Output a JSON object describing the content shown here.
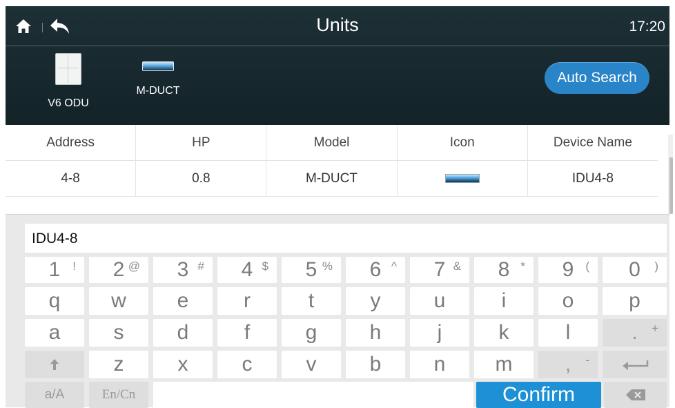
{
  "header": {
    "title": "Units",
    "time": "17:20",
    "devices": [
      {
        "label": "V6 ODU"
      },
      {
        "label": "M-DUCT"
      }
    ],
    "auto_search_label": "Auto Search"
  },
  "table": {
    "columns": [
      "Address",
      "HP",
      "Model",
      "Icon",
      "Device Name"
    ],
    "rows": [
      {
        "address": "4-8",
        "hp": "0.8",
        "model": "M-DUCT",
        "device_name": "IDU4-8"
      }
    ]
  },
  "keyboard": {
    "input_value": "IDU4-8",
    "number_row": [
      {
        "main": "1",
        "sub": "!"
      },
      {
        "main": "2",
        "sub": "@"
      },
      {
        "main": "3",
        "sub": "#"
      },
      {
        "main": "4",
        "sub": "$"
      },
      {
        "main": "5",
        "sub": "%"
      },
      {
        "main": "6",
        "sub": "^"
      },
      {
        "main": "7",
        "sub": "&"
      },
      {
        "main": "8",
        "sub": "*"
      },
      {
        "main": "9",
        "sub": "("
      },
      {
        "main": "0",
        "sub": ")"
      }
    ],
    "row_q": [
      "q",
      "w",
      "e",
      "r",
      "t",
      "y",
      "u",
      "i",
      "o",
      "p"
    ],
    "row_a": [
      "a",
      "s",
      "d",
      "f",
      "g",
      "h",
      "j",
      "k",
      "l"
    ],
    "period_key": {
      "main": ".",
      "sub": "+"
    },
    "row_z": [
      "z",
      "x",
      "c",
      "v",
      "b",
      "n",
      "m"
    ],
    "comma_key": {
      "main": ",",
      "sub": "-"
    },
    "case_label": "a/A",
    "lang_label": "En/Cn",
    "confirm_label": "Confirm"
  },
  "colors": {
    "header_bg": "#172a2f",
    "accent": "#1e90d6",
    "auto_search_bg": "#2a84c8"
  },
  "icons": [
    "home-icon",
    "back-icon",
    "odu-icon",
    "duct-icon",
    "shift-icon",
    "enter-icon",
    "backspace-icon"
  ]
}
